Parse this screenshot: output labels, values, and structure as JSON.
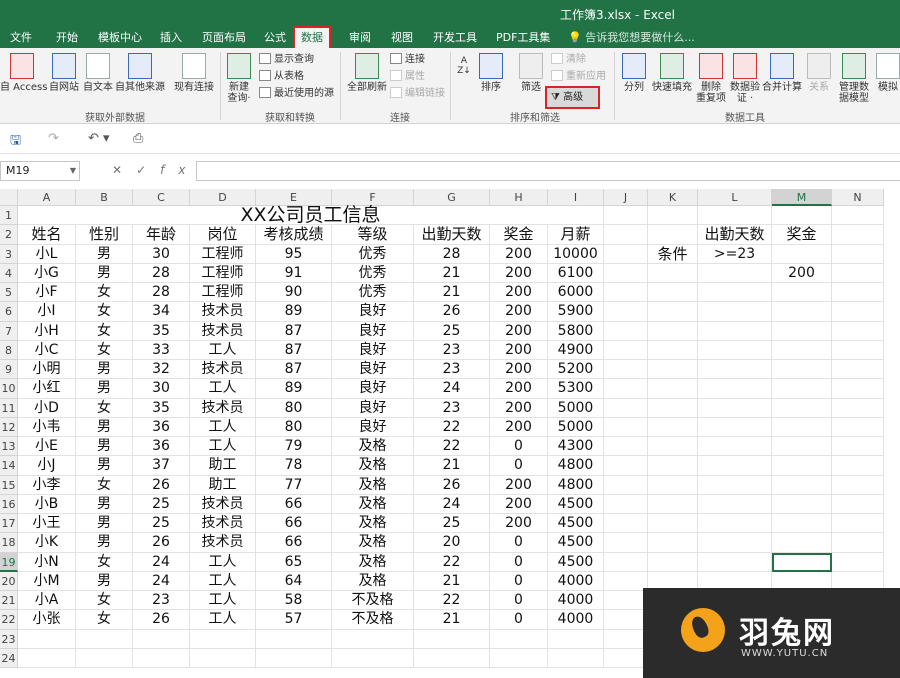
{
  "app": {
    "window_title": "工作簿3.xlsx - Excel",
    "tell_me": "告诉我您想要做什么..."
  },
  "tabs": [
    "文件",
    "开始",
    "模板中心",
    "插入",
    "页面布局",
    "公式",
    "数据",
    "审阅",
    "视图",
    "开发工具",
    "PDF工具集"
  ],
  "ribbon": {
    "groups": {
      "external": "获取外部数据",
      "transform": "获取和转换",
      "connections": "连接",
      "sort_filter": "排序和筛选",
      "data_tools": "数据工具"
    },
    "buttons": {
      "access": "自 Access",
      "web": "自网站",
      "text": "自文本",
      "other": "自其他来源",
      "existing": "现有连接",
      "new_query_1": "新建",
      "new_query_2": "查询·",
      "show_query": "显示查询",
      "from_table": "从表格",
      "recent": "最近使用的源",
      "refresh_all": "全部刷新",
      "connections": "连接",
      "properties": "属性",
      "edit_links": "编辑链接",
      "sort": "排序",
      "filter": "筛选",
      "clear": "清除",
      "reapply": "重新应用",
      "advanced": "高级",
      "text_to_cols": "分列",
      "flash_fill": "快速填充",
      "remove_dup_1": "删除",
      "remove_dup_2": "重复项",
      "validation_1": "数据验",
      "validation_2": "证 ·",
      "consolidate": "合并计算",
      "relations": "关系",
      "data_model_1": "管理数",
      "data_model_2": "据模型",
      "whatif": "模拟"
    }
  },
  "formula_bar": {
    "name_box": "M19",
    "formula": ""
  },
  "sheet": {
    "columns": [
      "A",
      "B",
      "C",
      "D",
      "E",
      "F",
      "G",
      "H",
      "I",
      "J",
      "K",
      "L",
      "M",
      "N"
    ],
    "rows": [
      "1",
      "2",
      "3",
      "4",
      "5",
      "6",
      "7",
      "8",
      "9",
      "10",
      "11",
      "12",
      "13",
      "14",
      "15",
      "16",
      "17",
      "18",
      "19",
      "20",
      "21",
      "22",
      "23",
      "24"
    ],
    "title": "XX公司员工信息",
    "headers": [
      "姓名",
      "性别",
      "年龄",
      "岗位",
      "考核成绩",
      "等级",
      "出勤天数",
      "奖金",
      "月薪"
    ],
    "data": [
      [
        "小L",
        "男",
        "30",
        "工程师",
        "95",
        "优秀",
        "28",
        "200",
        "10000"
      ],
      [
        "小G",
        "男",
        "28",
        "工程师",
        "91",
        "优秀",
        "21",
        "200",
        "6100"
      ],
      [
        "小F",
        "女",
        "28",
        "工程师",
        "90",
        "优秀",
        "21",
        "200",
        "6000"
      ],
      [
        "小I",
        "女",
        "34",
        "技术员",
        "89",
        "良好",
        "26",
        "200",
        "5900"
      ],
      [
        "小H",
        "女",
        "35",
        "技术员",
        "87",
        "良好",
        "25",
        "200",
        "5800"
      ],
      [
        "小C",
        "女",
        "33",
        "工人",
        "87",
        "良好",
        "23",
        "200",
        "4900"
      ],
      [
        "小明",
        "男",
        "32",
        "技术员",
        "87",
        "良好",
        "23",
        "200",
        "5200"
      ],
      [
        "小红",
        "男",
        "30",
        "工人",
        "89",
        "良好",
        "24",
        "200",
        "5300"
      ],
      [
        "小D",
        "女",
        "35",
        "技术员",
        "80",
        "良好",
        "23",
        "200",
        "5000"
      ],
      [
        "小韦",
        "男",
        "36",
        "工人",
        "80",
        "良好",
        "22",
        "200",
        "5000"
      ],
      [
        "小E",
        "男",
        "36",
        "工人",
        "79",
        "及格",
        "22",
        "0",
        "4300"
      ],
      [
        "小J",
        "男",
        "37",
        "助工",
        "78",
        "及格",
        "21",
        "0",
        "4800"
      ],
      [
        "小李",
        "女",
        "26",
        "助工",
        "77",
        "及格",
        "26",
        "200",
        "4800"
      ],
      [
        "小B",
        "男",
        "25",
        "技术员",
        "66",
        "及格",
        "24",
        "200",
        "4500"
      ],
      [
        "小王",
        "男",
        "25",
        "技术员",
        "66",
        "及格",
        "25",
        "200",
        "4500"
      ],
      [
        "小K",
        "男",
        "26",
        "技术员",
        "66",
        "及格",
        "20",
        "0",
        "4500"
      ],
      [
        "小N",
        "女",
        "24",
        "工人",
        "65",
        "及格",
        "22",
        "0",
        "4500"
      ],
      [
        "小M",
        "男",
        "24",
        "工人",
        "64",
        "及格",
        "21",
        "0",
        "4000"
      ],
      [
        "小A",
        "女",
        "23",
        "工人",
        "58",
        "不及格",
        "22",
        "0",
        "4000"
      ],
      [
        "小张",
        "女",
        "26",
        "工人",
        "57",
        "不及格",
        "21",
        "0",
        "4000"
      ]
    ],
    "criteria": {
      "label": "条件",
      "header_l": "出勤天数",
      "header_m": "奖金",
      "value_l": ">=23",
      "value_m": "200"
    }
  },
  "watermark": {
    "brand": "羽兔网",
    "url": "WWW.YUTU.CN"
  }
}
